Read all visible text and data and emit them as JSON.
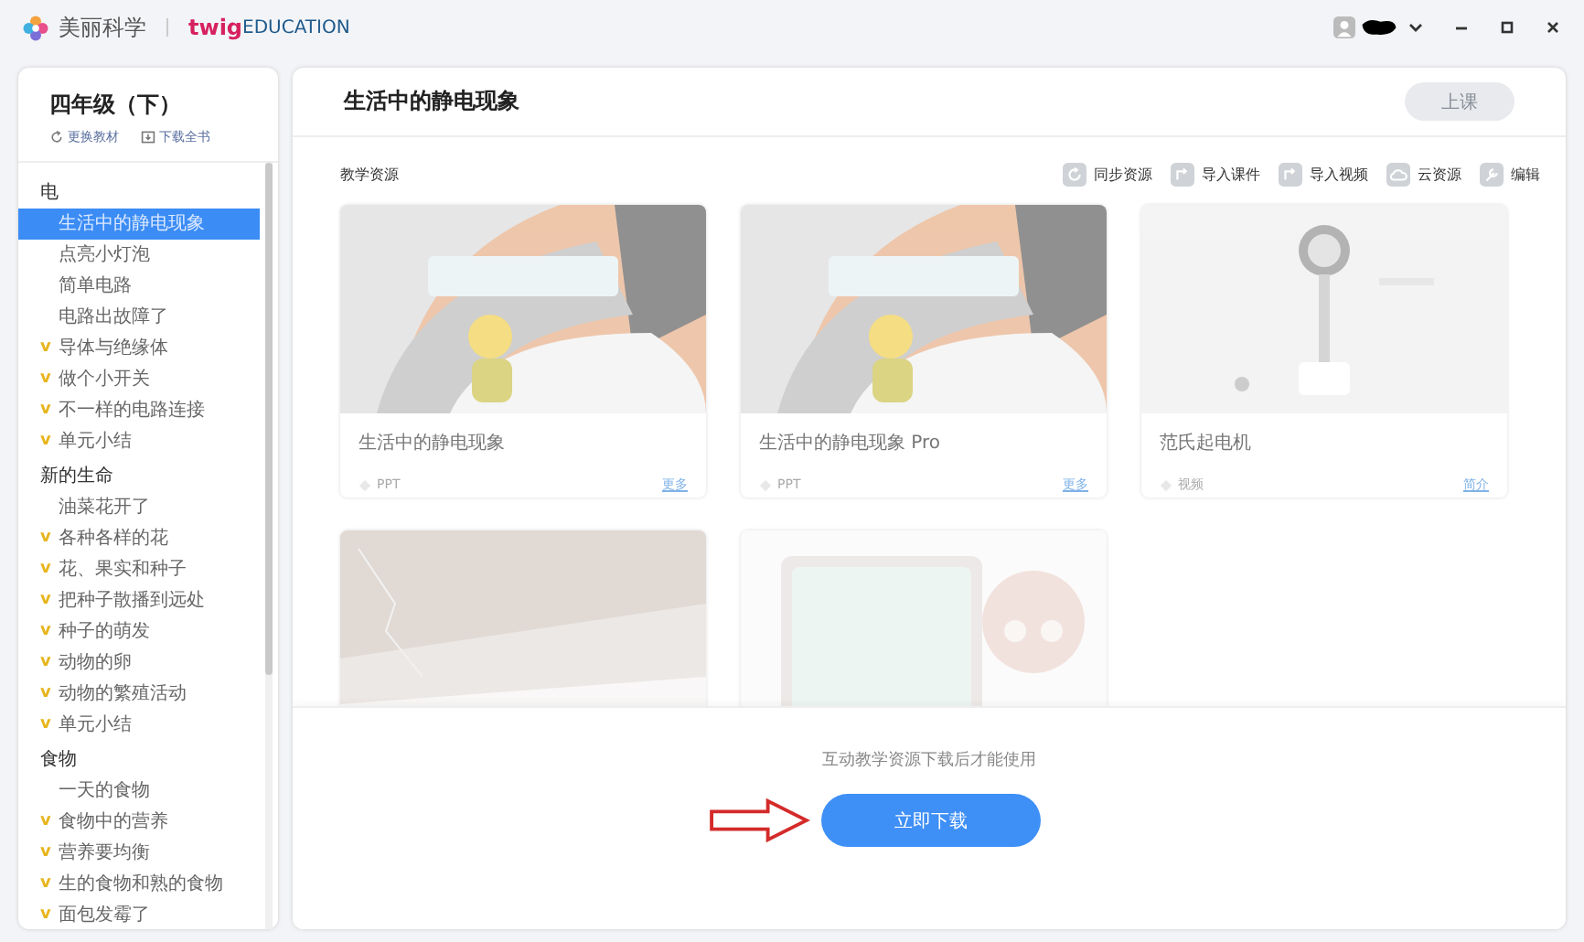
{
  "titlebar": {
    "app_name": "美丽科学",
    "brand_main": "twig",
    "brand_sub": "EDUCATION"
  },
  "sidebar": {
    "title": "四年级（下）",
    "actions": [
      "更换教材",
      "下载全书"
    ],
    "units": [
      {
        "name": "电",
        "lessons": [
          {
            "label": "生活中的静电现象",
            "selected": true
          },
          {
            "label": "点亮小灯泡",
            "selected": false
          },
          {
            "label": "简单电路",
            "selected": false
          },
          {
            "label": "电路出故障了",
            "selected": false
          },
          {
            "label": "导体与绝缘体",
            "badge": "v",
            "selected": false
          },
          {
            "label": "做个小开关",
            "badge": "v",
            "selected": false
          },
          {
            "label": "不一样的电路连接",
            "badge": "v",
            "selected": false
          },
          {
            "label": "单元小结",
            "badge": "v",
            "selected": false
          }
        ]
      },
      {
        "name": "新的生命",
        "lessons": [
          {
            "label": "油菜花开了",
            "selected": false
          },
          {
            "label": "各种各样的花",
            "badge": "v",
            "selected": false
          },
          {
            "label": "花、果实和种子",
            "badge": "v",
            "selected": false
          },
          {
            "label": "把种子散播到远处",
            "badge": "v",
            "selected": false
          },
          {
            "label": "种子的萌发",
            "badge": "v",
            "selected": false
          },
          {
            "label": "动物的卵",
            "badge": "v",
            "selected": false
          },
          {
            "label": "动物的繁殖活动",
            "badge": "v",
            "selected": false
          },
          {
            "label": "单元小结",
            "badge": "v",
            "selected": false
          }
        ]
      },
      {
        "name": "食物",
        "lessons": [
          {
            "label": "一天的食物",
            "selected": false
          },
          {
            "label": "食物中的营养",
            "badge": "v",
            "selected": false
          },
          {
            "label": "营养要均衡",
            "badge": "v",
            "selected": false
          },
          {
            "label": "生的食物和熟的食物",
            "badge": "v",
            "selected": false
          },
          {
            "label": "面包发霉了",
            "badge": "v",
            "selected": false
          }
        ]
      }
    ]
  },
  "main": {
    "title": "生活中的静电现象",
    "class_button": {
      "label": "上课",
      "disabled": true
    },
    "section_label": "教学资源",
    "tools": [
      {
        "label": "同步资源",
        "kind": "sync"
      },
      {
        "label": "导入课件",
        "kind": "import"
      },
      {
        "label": "导入视频",
        "kind": "import"
      },
      {
        "label": "云资源",
        "kind": "cloud"
      },
      {
        "label": "编辑",
        "kind": "edit"
      }
    ],
    "resources": [
      {
        "kind": "cartoon",
        "title": "生活中的静电现象",
        "type": "PPT",
        "link": "更多"
      },
      {
        "kind": "cartoon",
        "title": "生活中的静电现象 Pro",
        "type": "PPT",
        "link": "更多"
      },
      {
        "kind": "device",
        "title": "范氏起电机",
        "type": "视频",
        "link": "简介"
      },
      {
        "kind": "lightning"
      },
      {
        "kind": "quiz"
      }
    ],
    "notice": {
      "message": "互动教学资源下载后才能使用",
      "button": "立即下载"
    }
  }
}
